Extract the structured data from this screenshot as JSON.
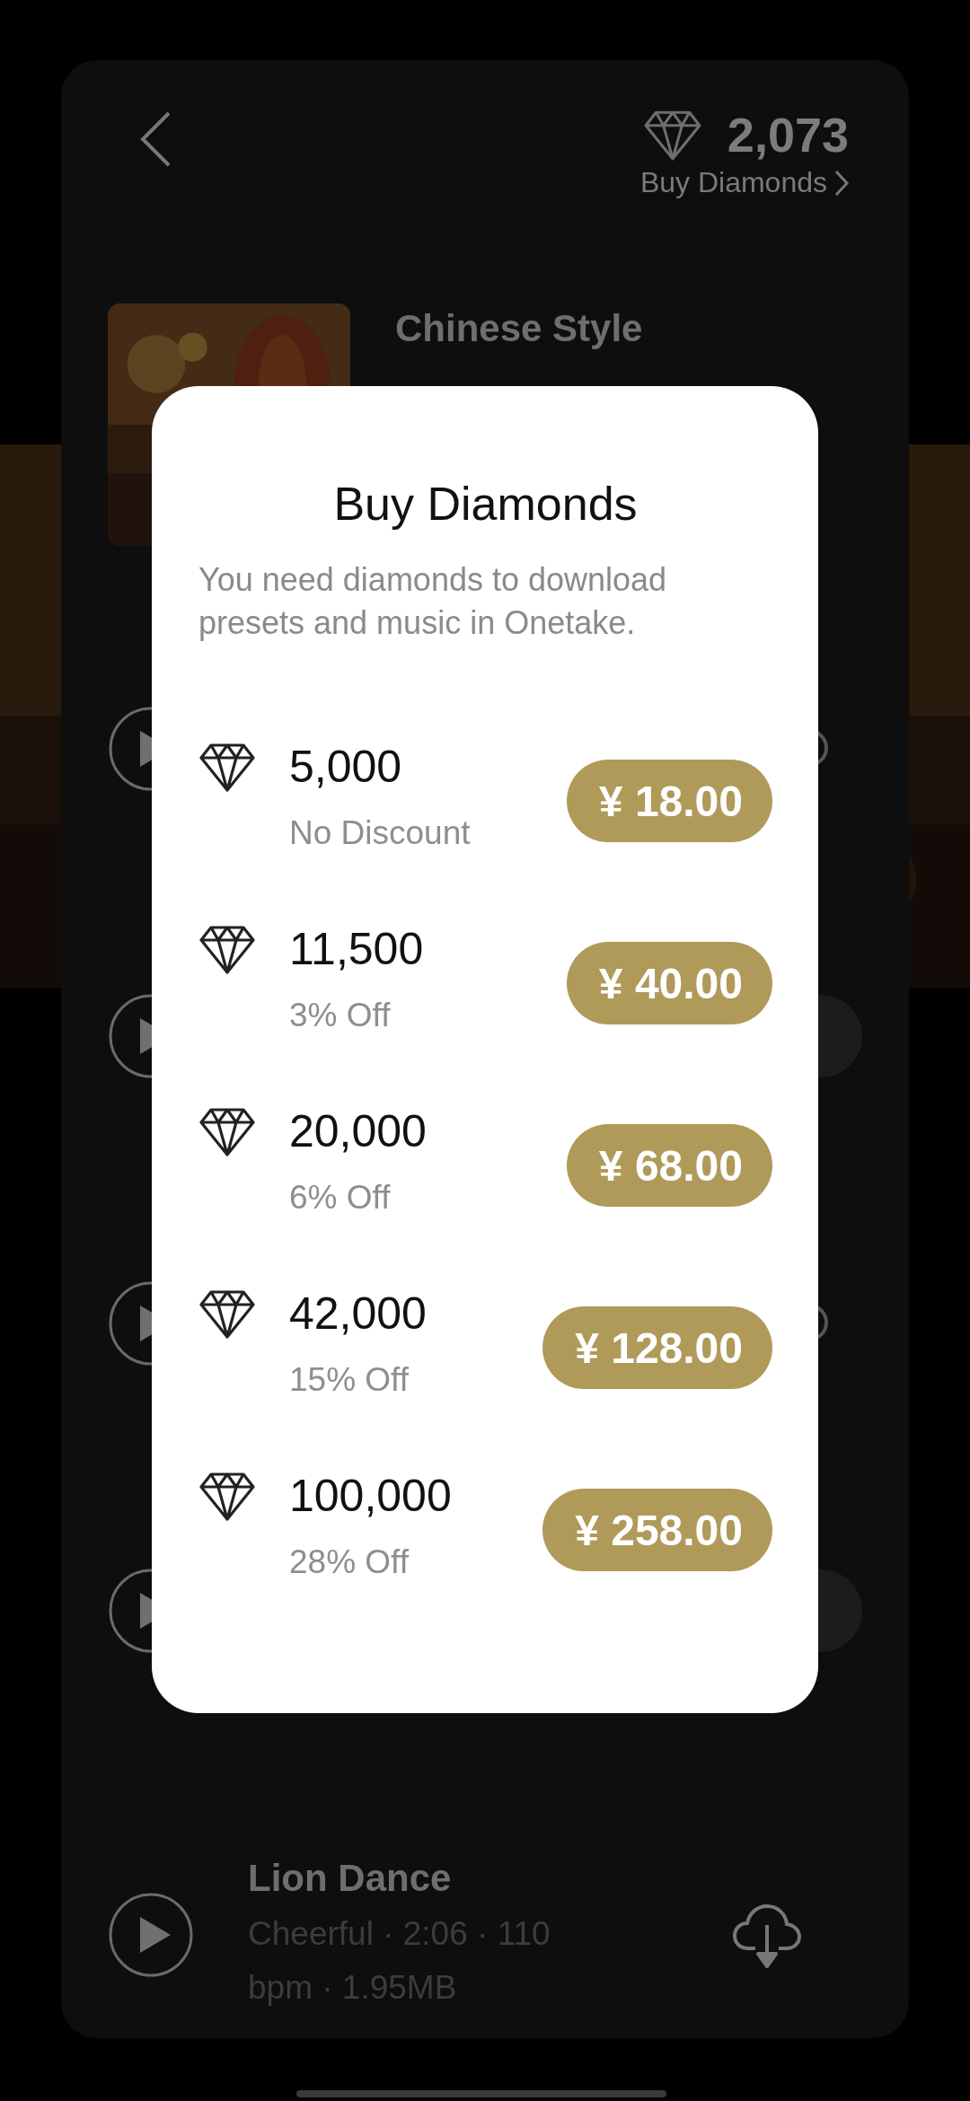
{
  "header": {
    "balance": "2,073",
    "buy_link": "Buy Diamonds"
  },
  "album": {
    "kind": "picture",
    "title": "Chinese Style"
  },
  "covered_tracks": [
    {
      "kind": "icon"
    },
    {
      "kind": "button"
    },
    {
      "kind": "icon"
    },
    {
      "kind": "button"
    }
  ],
  "dialog": {
    "title": "Buy Diamonds",
    "message": "You need diamonds to download presets and music in Onetake.",
    "packages": [
      {
        "amount": "5,000",
        "discount": "No Discount",
        "price": "¥ 18.00"
      },
      {
        "amount": "11,500",
        "discount": "3% Off",
        "price": "¥ 40.00"
      },
      {
        "amount": "20,000",
        "discount": "6% Off",
        "price": "¥ 68.00"
      },
      {
        "amount": "42,000",
        "discount": "15% Off",
        "price": "¥ 128.00"
      },
      {
        "amount": "100,000",
        "discount": "28% Off",
        "price": "¥ 258.00"
      }
    ]
  },
  "track": {
    "title": "Lion Dance",
    "meta": "Cheerful · 2:06 · 110 bpm · 1.95MB"
  }
}
